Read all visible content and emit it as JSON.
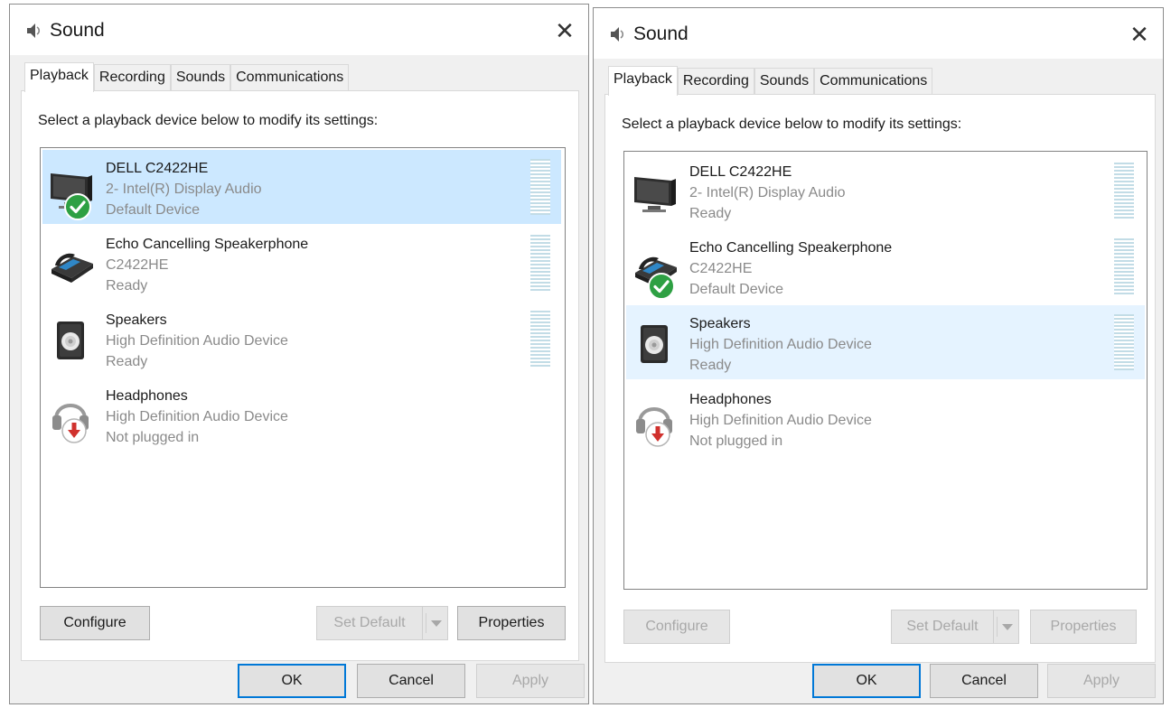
{
  "dialogs": [
    {
      "title": "Sound",
      "close_glyph": "✕",
      "tabs": [
        "Playback",
        "Recording",
        "Sounds",
        "Communications"
      ],
      "active_tab": "Playback",
      "instruction": "Select a playback device below to modify its settings:",
      "devices": [
        {
          "name": "DELL C2422HE",
          "sub": "2- Intel(R) Display Audio",
          "status": "Default Device",
          "icon": "monitor-icon",
          "badge": "default-check-icon",
          "state": "selected"
        },
        {
          "name": "Echo Cancelling Speakerphone",
          "sub": "C2422HE",
          "status": "Ready",
          "icon": "speakerphone-icon",
          "badge": "",
          "state": ""
        },
        {
          "name": "Speakers",
          "sub": "High Definition Audio Device",
          "status": "Ready",
          "icon": "speaker-icon",
          "badge": "",
          "state": ""
        },
        {
          "name": "Headphones",
          "sub": "High Definition Audio Device",
          "status": "Not plugged in",
          "icon": "headphones-icon",
          "badge": "unplugged-icon",
          "state": ""
        }
      ],
      "buttons": {
        "configure": "Configure",
        "set_default": "Set Default",
        "properties": "Properties",
        "ok": "OK",
        "cancel": "Cancel",
        "apply": "Apply"
      }
    },
    {
      "title": "Sound",
      "close_glyph": "✕",
      "tabs": [
        "Playback",
        "Recording",
        "Sounds",
        "Communications"
      ],
      "active_tab": "Playback",
      "instruction": "Select a playback device below to modify its settings:",
      "devices": [
        {
          "name": "DELL C2422HE",
          "sub": "2- Intel(R) Display Audio",
          "status": "Ready",
          "icon": "monitor-icon",
          "badge": "",
          "state": ""
        },
        {
          "name": "Echo Cancelling Speakerphone",
          "sub": "C2422HE",
          "status": "Default Device",
          "icon": "speakerphone-icon",
          "badge": "default-check-icon",
          "state": ""
        },
        {
          "name": "Speakers",
          "sub": "High Definition Audio Device",
          "status": "Ready",
          "icon": "speaker-icon",
          "badge": "",
          "state": "hovered"
        },
        {
          "name": "Headphones",
          "sub": "High Definition Audio Device",
          "status": "Not plugged in",
          "icon": "headphones-icon",
          "badge": "unplugged-icon",
          "state": ""
        }
      ],
      "buttons": {
        "configure": "Configure",
        "set_default": "Set Default",
        "properties": "Properties",
        "ok": "OK",
        "cancel": "Cancel",
        "apply": "Apply"
      }
    }
  ],
  "colors": {
    "selection": "#cce8ff",
    "hover": "#e5f3ff",
    "focus_border": "#0078d7",
    "check_green": "#2ea043",
    "unplug_red": "#d0312d"
  }
}
